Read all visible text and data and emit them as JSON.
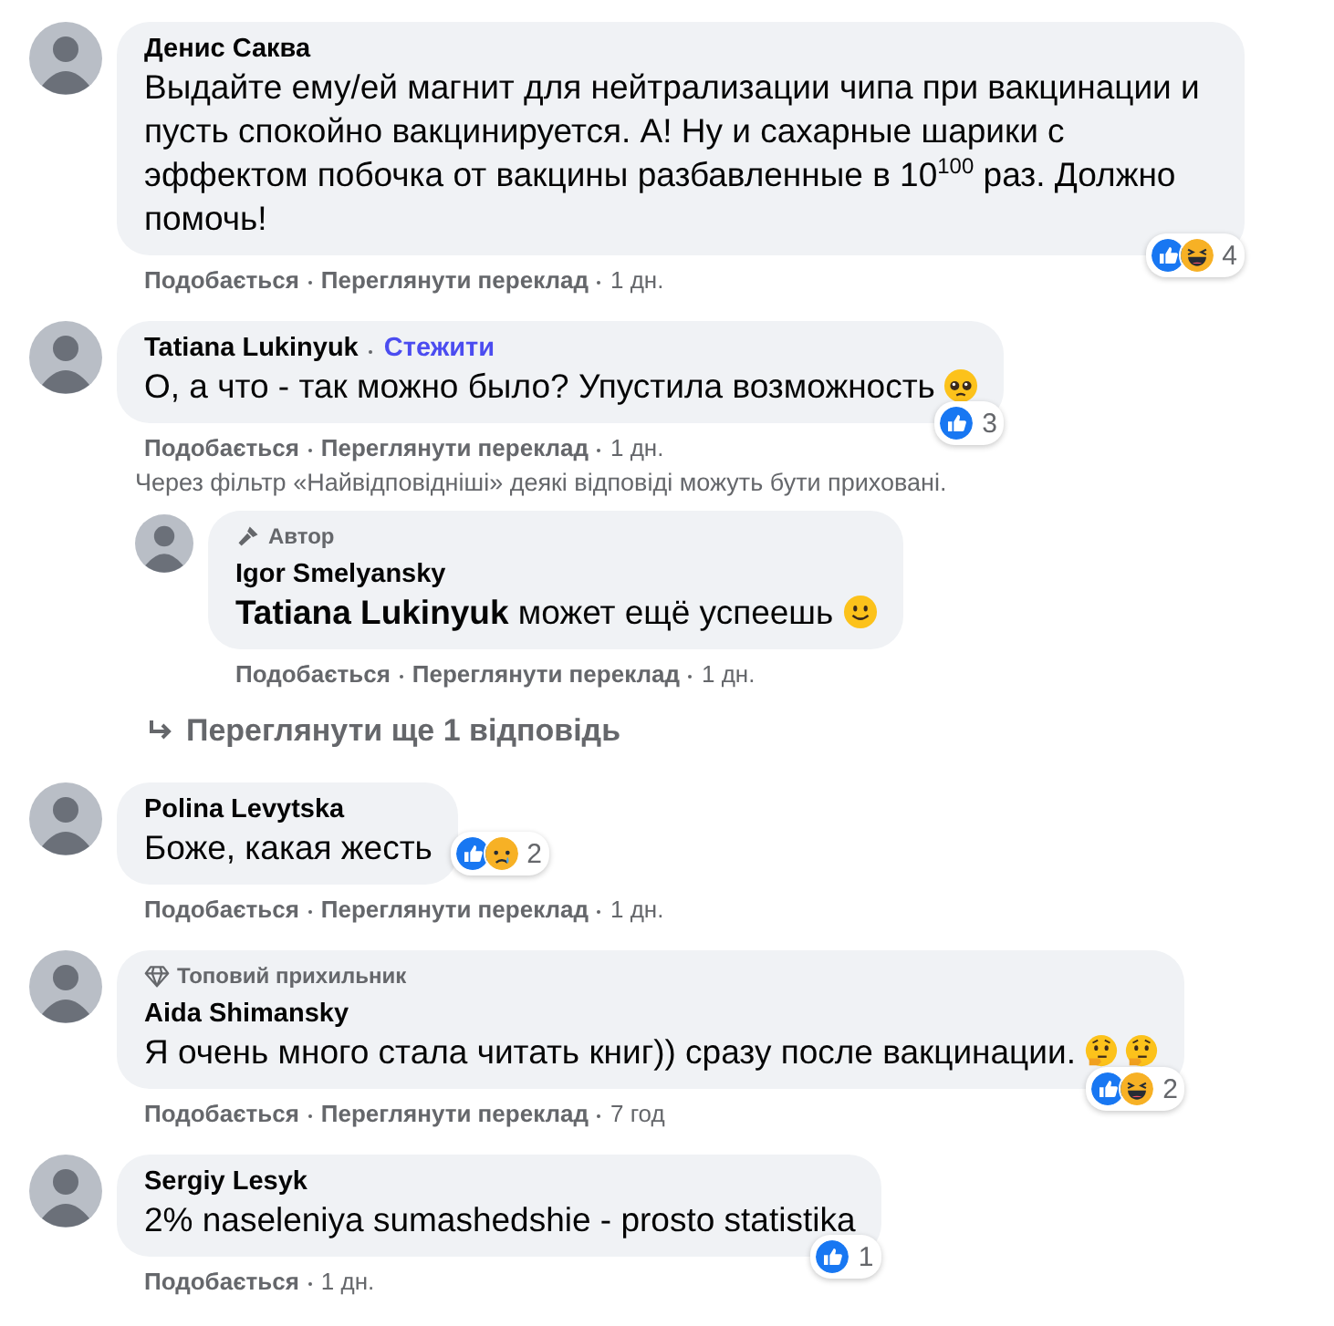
{
  "items": [
    {
      "kind": "comment",
      "author": "Денис Саква",
      "text": "Выдайте ему/ей магнит для нейтрализации чипа при вакцинации и пусть спокойно вакцинируется. А! Ну и сахарные шарики с эффектом побочка от вакцины разбавленные в 10$^{100}$ раз. Должно помочь!",
      "reactions": {
        "icons": [
          {
            "kind": "like"
          },
          {
            "kind": "haha"
          }
        ],
        "count": "4"
      },
      "actions": [
        "Подобається",
        "Переглянути переклад"
      ],
      "time": "1 дн."
    },
    {
      "kind": "comment",
      "author": "Tatiana Lukinyuk",
      "follow": "Стежити",
      "text": "О, а что - так можно было? Упустила возможность",
      "emoji": [
        {
          "kind": "pleading"
        }
      ],
      "reactions": {
        "icons": [
          {
            "kind": "like"
          }
        ],
        "count": "3"
      },
      "actions": [
        "Подобається",
        "Переглянути переклад"
      ],
      "time": "1 дн."
    },
    {
      "kind": "note",
      "text": "Через фільтр «Найвідповідніші» деякі відповіді можуть бути приховані."
    },
    {
      "kind": "reply",
      "badge": {
        "kind": "author",
        "label": "Автор"
      },
      "author": "Igor Smelyansky",
      "mention": "Tatiana Lukinyuk",
      "text": "может ещё успеешь",
      "emoji": [
        {
          "kind": "smile"
        }
      ],
      "actions": [
        "Подобається",
        "Переглянути переклад"
      ],
      "time": "1 дн."
    },
    {
      "kind": "more",
      "text": "Переглянути ще 1 відповідь"
    },
    {
      "kind": "comment",
      "author": "Polina Levytska",
      "text": "Боже, какая жесть",
      "reactions": {
        "icons": [
          {
            "kind": "like"
          },
          {
            "kind": "sad"
          }
        ],
        "count": "2"
      },
      "actions": [
        "Подобається",
        "Переглянути переклад"
      ],
      "time": "1 дн."
    },
    {
      "kind": "comment",
      "badge": {
        "kind": "fan",
        "label": "Топовий прихильник"
      },
      "author": "Aida Shimansky",
      "text": "Я очень много стала читать книг)) сразу после вакцинации.",
      "emoji": [
        {
          "kind": "thinking"
        },
        {
          "kind": "thinking"
        }
      ],
      "reactions": {
        "icons": [
          {
            "kind": "like"
          },
          {
            "kind": "haha"
          }
        ],
        "count": "2"
      },
      "actions": [
        "Подобається",
        "Переглянути переклад"
      ],
      "time": "7 год"
    },
    {
      "kind": "comment",
      "author": "Sergiy Lesyk",
      "text": "2% naseleniya sumashedshie - prosto statistika",
      "reactions": {
        "icons": [
          {
            "kind": "like"
          }
        ],
        "count": "1"
      },
      "actions": [
        "Подобається"
      ],
      "time": "1 дн."
    }
  ]
}
